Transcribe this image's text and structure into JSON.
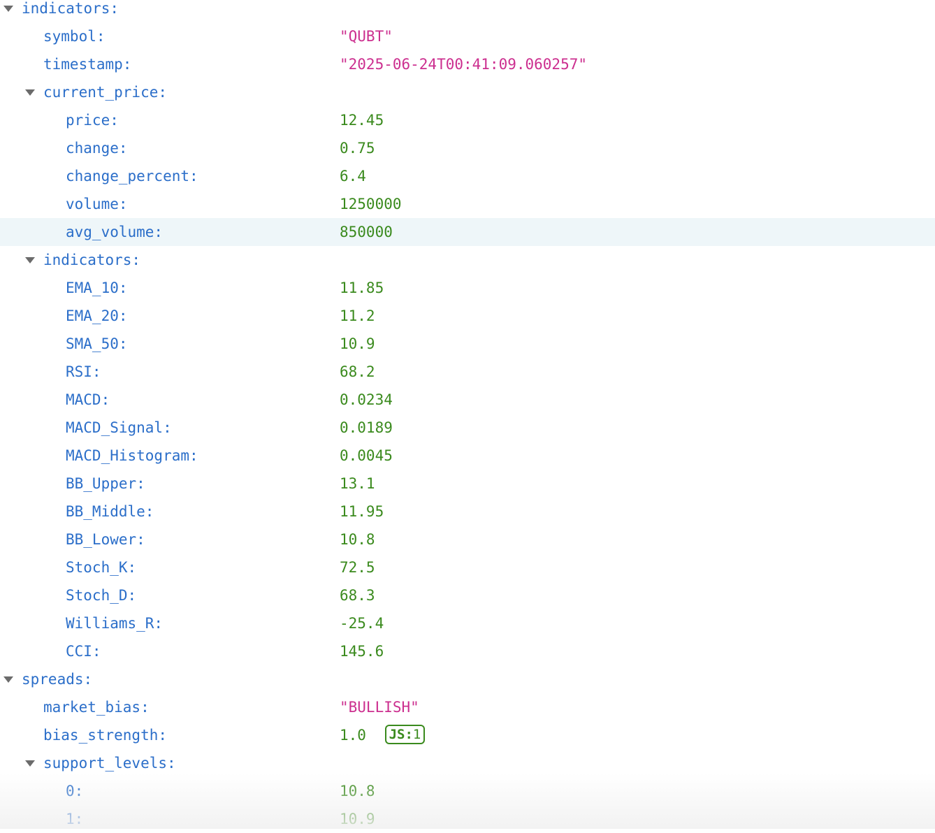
{
  "json_viewer": {
    "rows": [
      {
        "key": "indicators:",
        "value": "",
        "value_type": "",
        "toggle": true
      },
      {
        "key": "symbol:",
        "value": "\"QUBT\"",
        "value_type": "string"
      },
      {
        "key": "timestamp:",
        "value": "\"2025-06-24T00:41:09.060257\"",
        "value_type": "string"
      },
      {
        "key": "current_price:",
        "value": "",
        "value_type": "",
        "toggle": true
      },
      {
        "key": "price:",
        "value": "12.45",
        "value_type": "number"
      },
      {
        "key": "change:",
        "value": "0.75",
        "value_type": "number"
      },
      {
        "key": "change_percent:",
        "value": "6.4",
        "value_type": "number"
      },
      {
        "key": "volume:",
        "value": "1250000",
        "value_type": "number"
      },
      {
        "key": "avg_volume:",
        "value": "850000",
        "value_type": "number",
        "highlighted": true
      },
      {
        "key": "indicators:",
        "value": "",
        "value_type": "",
        "toggle": true
      },
      {
        "key": "EMA_10:",
        "value": "11.85",
        "value_type": "number"
      },
      {
        "key": "EMA_20:",
        "value": "11.2",
        "value_type": "number"
      },
      {
        "key": "SMA_50:",
        "value": "10.9",
        "value_type": "number"
      },
      {
        "key": "RSI:",
        "value": "68.2",
        "value_type": "number"
      },
      {
        "key": "MACD:",
        "value": "0.0234",
        "value_type": "number"
      },
      {
        "key": "MACD_Signal:",
        "value": "0.0189",
        "value_type": "number"
      },
      {
        "key": "MACD_Histogram:",
        "value": "0.0045",
        "value_type": "number"
      },
      {
        "key": "BB_Upper:",
        "value": "13.1",
        "value_type": "number"
      },
      {
        "key": "BB_Middle:",
        "value": "11.95",
        "value_type": "number"
      },
      {
        "key": "BB_Lower:",
        "value": "10.8",
        "value_type": "number"
      },
      {
        "key": "Stoch_K:",
        "value": "72.5",
        "value_type": "number"
      },
      {
        "key": "Stoch_D:",
        "value": "68.3",
        "value_type": "number"
      },
      {
        "key": "Williams_R:",
        "value": "-25.4",
        "value_type": "number"
      },
      {
        "key": "CCI:",
        "value": "145.6",
        "value_type": "number"
      },
      {
        "key": "spreads:",
        "value": "",
        "value_type": "",
        "toggle": true
      },
      {
        "key": "market_bias:",
        "value": "\"BULLISH\"",
        "value_type": "string"
      },
      {
        "key": "bias_strength:",
        "value": "1.0",
        "value_type": "number",
        "badge_label": "JS:",
        "badge_value": "1"
      },
      {
        "key": "support_levels:",
        "value": "",
        "value_type": "",
        "toggle": true
      },
      {
        "key": "0:",
        "value": "10.8",
        "value_type": "number"
      },
      {
        "key": "1:",
        "value": "10.9",
        "value_type": "number"
      }
    ]
  },
  "colors": {
    "key": "#2b6ec9",
    "string": "#cc2f8f",
    "number": "#3a8a1d",
    "twisty": "#6b6b6b",
    "highlight": "#eef6f9"
  }
}
